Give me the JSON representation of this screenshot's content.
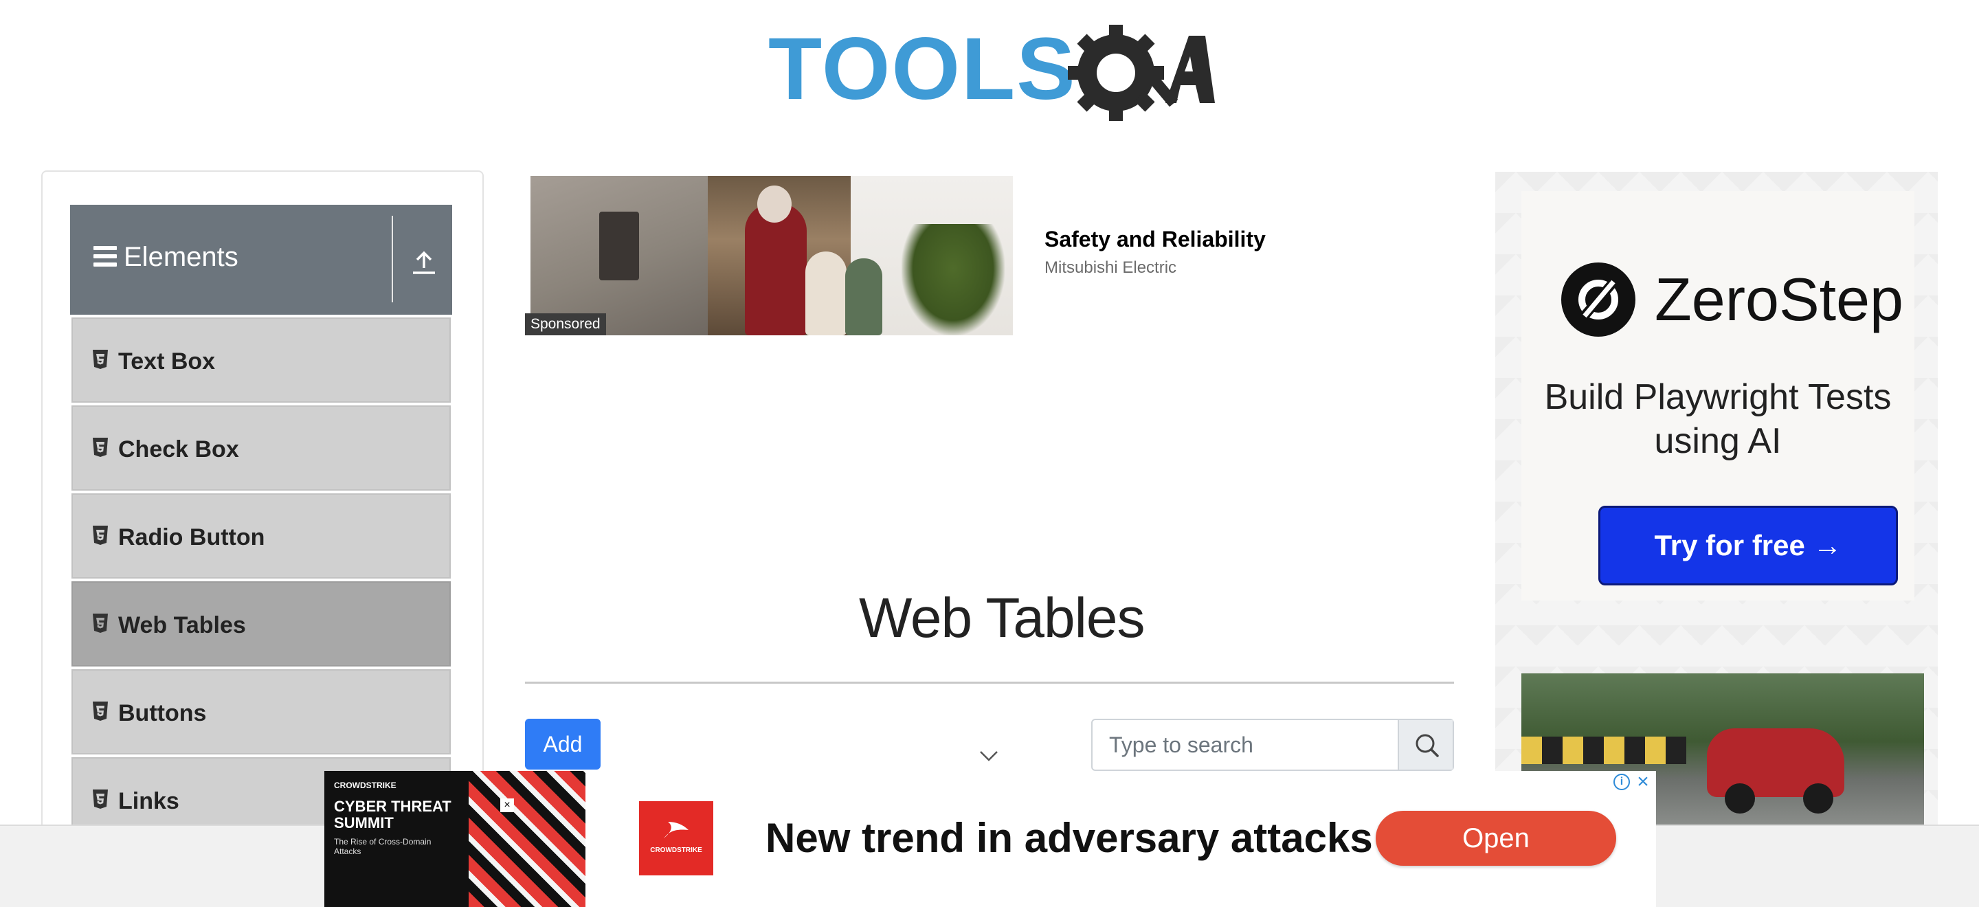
{
  "brand": {
    "logo_text": "TOOLSQA",
    "accent": "#3f9bd6",
    "dark": "#2b2b2b"
  },
  "sidebar": {
    "group_title": "Elements",
    "group_icon": "hamburger-icon",
    "collapse_icon": "upload-icon",
    "header_color": "#6c757d",
    "items": [
      {
        "label": "Text Box",
        "icon": "html5-icon"
      },
      {
        "label": "Check Box",
        "icon": "html5-icon"
      },
      {
        "label": "Radio Button",
        "icon": "html5-icon"
      },
      {
        "label": "Web Tables",
        "icon": "html5-icon",
        "active": true
      },
      {
        "label": "Buttons",
        "icon": "html5-icon"
      },
      {
        "label": "Links",
        "icon": "html5-icon"
      }
    ]
  },
  "sponsored_ad": {
    "tag": "Sponsored",
    "title": "Safety and Reliability",
    "advertiser": "Mitsubishi Electric"
  },
  "main": {
    "header": "Web Tables",
    "add_label": "Add",
    "search_placeholder": "Type to search",
    "add_color": "#2f7cf6"
  },
  "right_ad": {
    "brand": "ZeroStep",
    "tagline": "Build Playwright Tests using AI",
    "cta": "Try for free →",
    "cta_color": "#1435e8"
  },
  "bottom_ad": {
    "thumb_brand": "CROWDSTRIKE",
    "thumb_title": "CYBER THREAT SUMMIT",
    "thumb_subtitle": "The Rise of Cross-Domain Attacks",
    "logo_text": "CROWDSTRIKE",
    "headline": "New trend in adversary attacks",
    "cta": "Open",
    "cta_color": "#e44d37"
  }
}
